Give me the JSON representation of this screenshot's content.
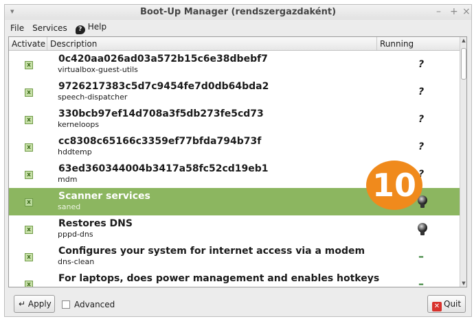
{
  "window": {
    "title": "Boot-Up Manager (rendszergazdaként)",
    "controls": [
      "–",
      "+",
      "×"
    ]
  },
  "menu": {
    "file": "File",
    "services": "Services",
    "help": "Help"
  },
  "table": {
    "headers": [
      "Activate",
      "Description",
      "Running"
    ],
    "rows": [
      {
        "name": "0c420aa026ad03a572b15c6e38dbebf7",
        "service": "virtualbox-guest-utils",
        "status": "?"
      },
      {
        "name": "9726217383c5d7c9454fe7d0db64bda2",
        "service": "speech-dispatcher",
        "status": "?"
      },
      {
        "name": "330bcb97ef14d708a3f5db273fe5cd73",
        "service": "kerneloops",
        "status": "?"
      },
      {
        "name": "cc8308c65166c3359ef77bfda794b73f",
        "service": "hddtemp",
        "status": "?"
      },
      {
        "name": "63ed360344004b3417a58fc52cd19eb1",
        "service": "mdm",
        "status": "?"
      },
      {
        "name": "Scanner services",
        "service": "saned",
        "status": "bulb"
      },
      {
        "name": "Restores DNS",
        "service": "pppd-dns",
        "status": "bulb"
      },
      {
        "name": "Configures your system for internet access via a modem",
        "service": "dns-clean",
        "status": "–"
      },
      {
        "name": "For laptops, does  power management and enables hotkeys",
        "service": "",
        "status": "–"
      }
    ]
  },
  "badge": "10",
  "bottom": {
    "apply": "Apply",
    "advanced": "Advanced",
    "quit": "Quit"
  },
  "colors": {
    "selected_row": "#8cb660",
    "badge": "#f08a1c",
    "quit_icon": "#d8322c"
  }
}
